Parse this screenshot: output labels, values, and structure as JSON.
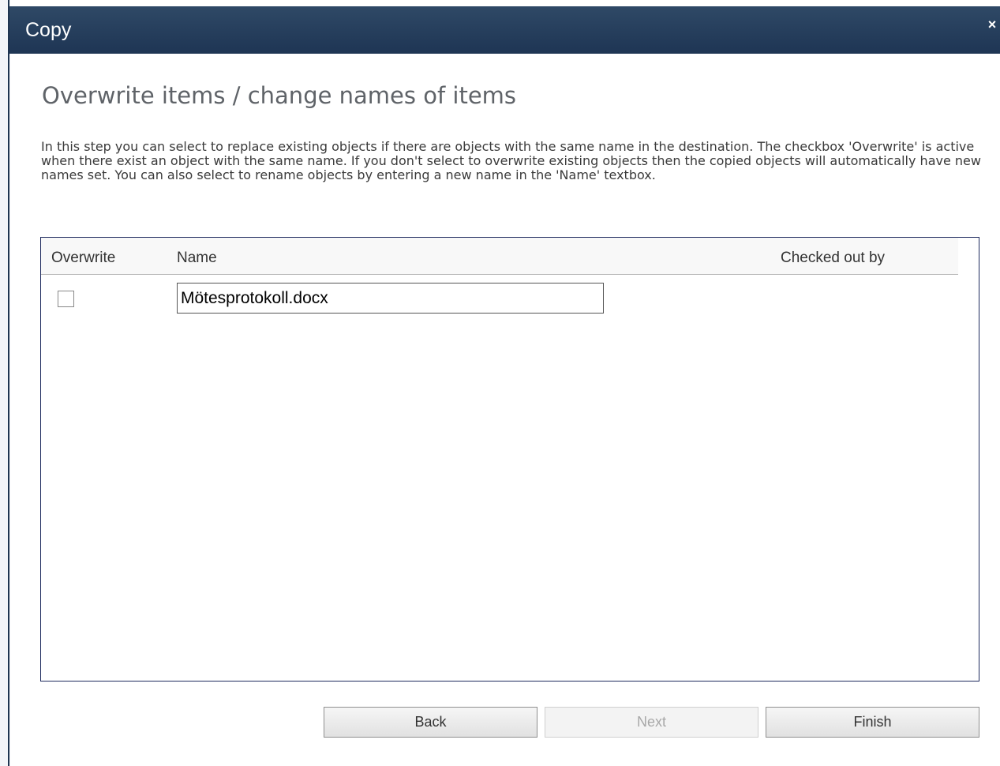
{
  "dialog": {
    "title": "Copy",
    "close_symbol": "×"
  },
  "heading": "Overwrite items / change names of items",
  "description": "In this step you can select to replace existing objects if there are objects with the same name in the destination. The checkbox 'Overwrite' is active when there exist an object with the same name. If you don't select to overwrite existing objects then the copied objects will automatically have new names set. You can also select to rename objects by entering a new name in the 'Name' textbox.",
  "table": {
    "columns": {
      "overwrite": "Overwrite",
      "name": "Name",
      "checked_out_by": "Checked out by"
    },
    "rows": [
      {
        "overwrite_checked": false,
        "name": "Mötesprotokoll.docx",
        "checked_out_by": ""
      }
    ]
  },
  "buttons": {
    "back": "Back",
    "next": "Next",
    "finish": "Finish"
  },
  "icons": {
    "close": "close-icon"
  },
  "colors": {
    "titlebar": "#243d5d",
    "table_border": "#1e2a5e"
  }
}
